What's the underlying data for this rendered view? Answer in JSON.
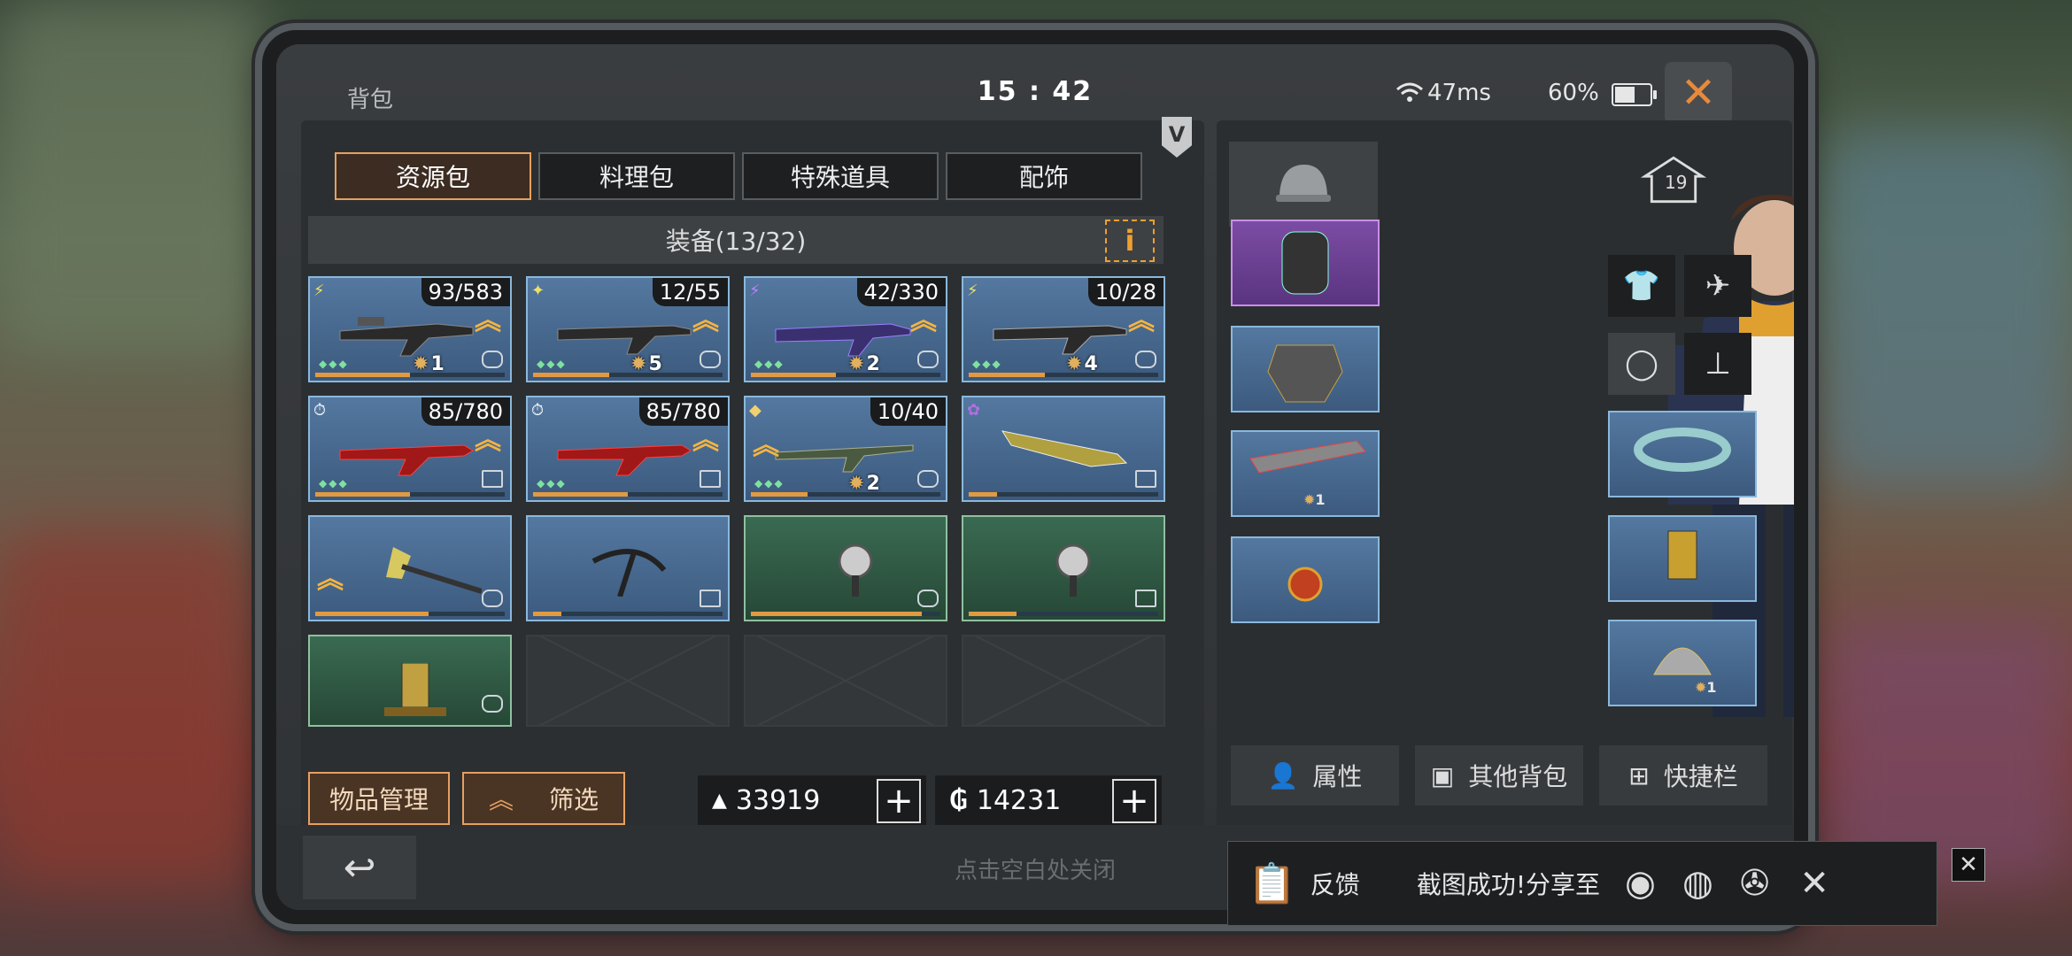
{
  "header": {
    "title": "背包",
    "clock": "15 : 42",
    "ping": "47ms",
    "battery": "60%",
    "battery_fraction": 0.6
  },
  "tabs": [
    {
      "label": "资源包",
      "active": true
    },
    {
      "label": "料理包",
      "active": false
    },
    {
      "label": "特殊道具",
      "active": false
    },
    {
      "label": "配饰",
      "active": false
    }
  ],
  "section": {
    "title": "装备(13/32)",
    "info_label": "i"
  },
  "items": [
    {
      "count": "93/583",
      "level": "1"
    },
    {
      "count": "12/55",
      "level": "5"
    },
    {
      "count": "42/330",
      "level": "2"
    },
    {
      "count": "10/28",
      "level": "4"
    },
    {
      "count": "85/780"
    },
    {
      "count": "85/780"
    },
    {
      "count": "10/40",
      "level": "2"
    },
    {},
    {},
    {},
    {},
    {},
    {}
  ],
  "actions": {
    "manage": "物品管理",
    "filter": "筛选"
  },
  "currency": {
    "gold": "33919",
    "coin": "14231",
    "plus": "+"
  },
  "right": {
    "level_badge": "19",
    "equip_level": "1",
    "equip_level2": "1",
    "attrs": "属性",
    "other_bag": "其他背包",
    "quickbar": "快捷栏"
  },
  "footer": {
    "hint": "点击空白处关闭"
  },
  "share": {
    "feedback": "反馈",
    "message": "截图成功!分享至",
    "close": "✕"
  },
  "colors": {
    "accent": "#e6a060",
    "close": "#e88a3a",
    "gold": "#f5b440"
  }
}
